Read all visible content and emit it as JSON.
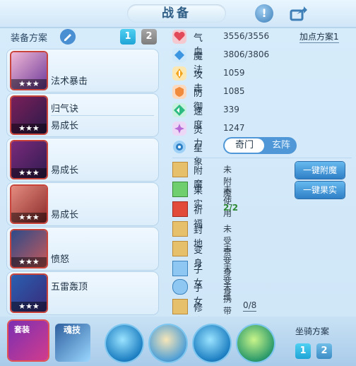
{
  "header": {
    "title": "战备",
    "help_symbol": "!"
  },
  "left": {
    "scheme_label": "装备方案",
    "scheme_tabs": [
      "1",
      "2"
    ],
    "slots": [
      {
        "lines": [
          "法术暴击"
        ],
        "stars": "★★★"
      },
      {
        "lines": [
          "归气诀",
          "易成长"
        ],
        "stars": "★★★"
      },
      {
        "lines": [
          "易成长"
        ],
        "stars": "★★★"
      },
      {
        "lines": [
          "易成长"
        ],
        "stars": "★★★"
      },
      {
        "lines": [
          "愤怒"
        ],
        "stars": "★★★"
      },
      {
        "lines": [
          "五雷轰顶"
        ],
        "stars": "★★★"
      }
    ]
  },
  "stats": {
    "plan_link": "加点方案1",
    "rows": [
      {
        "label": "气血",
        "value": "3556/3556"
      },
      {
        "label": "魔法",
        "value": "3806/3806"
      },
      {
        "label": "攻击",
        "value": "1059"
      },
      {
        "label": "防御",
        "value": "1085"
      },
      {
        "label": "速度",
        "value": "339"
      },
      {
        "label": "灵力",
        "value": "1247"
      }
    ],
    "xingxiang": {
      "label": "星象",
      "on": "奇门",
      "off": "玄阵"
    }
  },
  "actions": {
    "rows": [
      {
        "label": "附魔",
        "value": "未附魔"
      },
      {
        "label": "果实",
        "value": "未使用"
      },
      {
        "label": "祈福",
        "value": "2/2"
      },
      {
        "label": "封地",
        "value": "未受赏"
      },
      {
        "label": "变身",
        "value": "未变身"
      },
      {
        "label": "子女",
        "value": "未变身"
      },
      {
        "label": "子女",
        "value": "未携带"
      },
      {
        "label": "修炼觉醒",
        "value": "0/8"
      }
    ],
    "enchant_button": "一键附魔",
    "fruit_button": "一键果实"
  },
  "bottom": {
    "suit_label": "套装",
    "soul_label": "魂技",
    "mount_label": "坐骑方案",
    "mount_tabs": [
      "1",
      "2"
    ]
  }
}
